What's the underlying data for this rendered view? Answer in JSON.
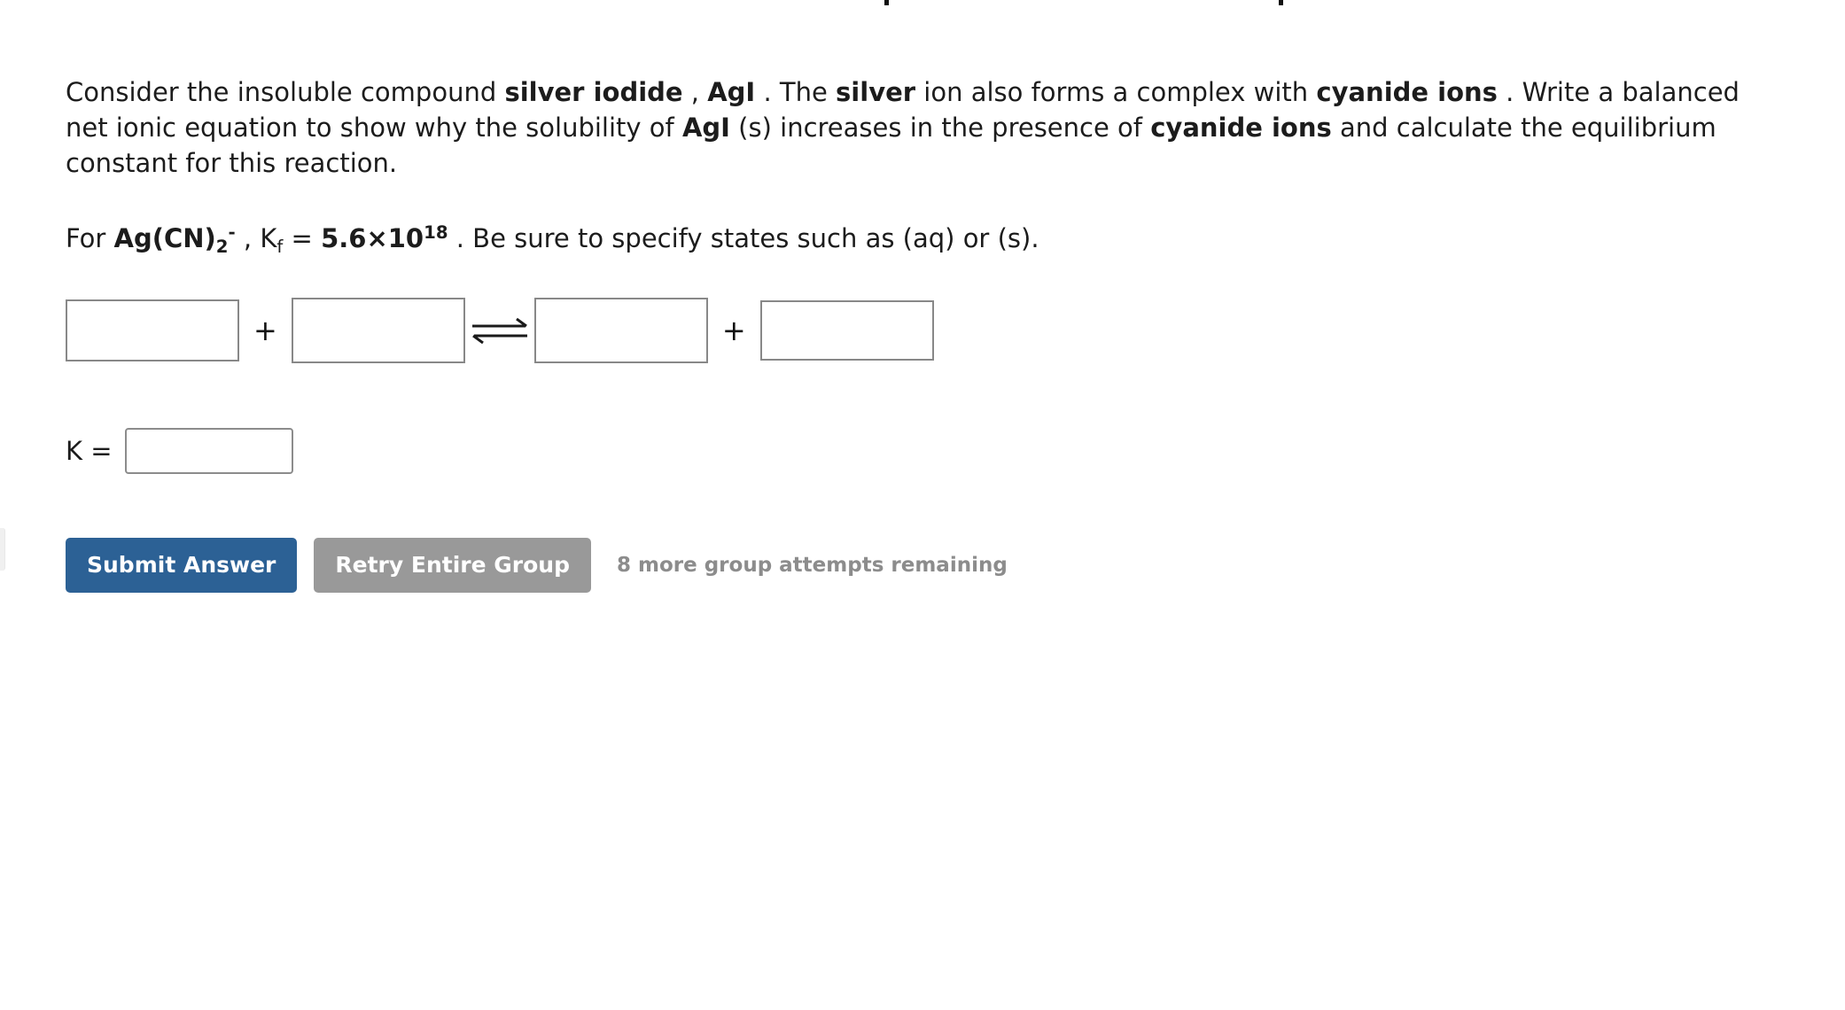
{
  "question": {
    "prompt_segments": [
      {
        "text": "Consider the insoluble compound ",
        "bold": false
      },
      {
        "text": "silver iodide",
        "bold": true
      },
      {
        "text": " , ",
        "bold": false
      },
      {
        "text": "AgI",
        "bold": true
      },
      {
        "text": " . The ",
        "bold": false
      },
      {
        "text": "silver",
        "bold": true
      },
      {
        "text": " ion also forms a complex with ",
        "bold": false
      },
      {
        "text": "cyanide ions",
        "bold": true
      },
      {
        "text": " . Write a balanced net ionic equation to show why the solubility of ",
        "bold": false
      },
      {
        "text": "AgI",
        "bold": true
      },
      {
        "text": " (s) increases in the presence of ",
        "bold": false
      },
      {
        "text": "cyanide ions",
        "bold": true
      },
      {
        "text": " and calculate the equilibrium constant for this reaction.",
        "bold": false
      }
    ],
    "prompt_plain": "Consider the insoluble compound silver iodide , AgI . The silver ion also forms a complex with cyanide ions . Write a balanced net ionic equation to show why the solubility of AgI (s) increases in the presence of cyanide ions and calculate the equilibrium constant for this reaction.",
    "kf_line": {
      "prefix": "For ",
      "complex_formula_base": "Ag(CN)",
      "complex_subscript": "2",
      "complex_superscript": "-",
      "separator": " , ",
      "k_symbol": "K",
      "k_subscript": "f",
      "equals": " = ",
      "value_mantissa": "5.6×10",
      "value_exponent": "18",
      "suffix": " . Be sure to specify states such as (aq) or (s)."
    }
  },
  "equation": {
    "reactant_1": {
      "value": "",
      "placeholder": ""
    },
    "reactant_2": {
      "value": "",
      "placeholder": ""
    },
    "product_1": {
      "value": "",
      "placeholder": ""
    },
    "product_2": {
      "value": "",
      "placeholder": ""
    },
    "plus_symbol": "+",
    "arrow_symbol": "⇌"
  },
  "equilibrium_constant": {
    "label": "K =",
    "value": "",
    "placeholder": ""
  },
  "actions": {
    "submit_label": "Submit Answer",
    "retry_label": "Retry Entire Group",
    "attempts_note": "8 more group attempts remaining"
  },
  "colors": {
    "submit_button": "#2c6195",
    "retry_button": "#999999",
    "attempts_note_text": "#8c8c8c",
    "input_border": "#888888",
    "body_text": "#1c1c1c",
    "page_background": "#ffffff"
  }
}
